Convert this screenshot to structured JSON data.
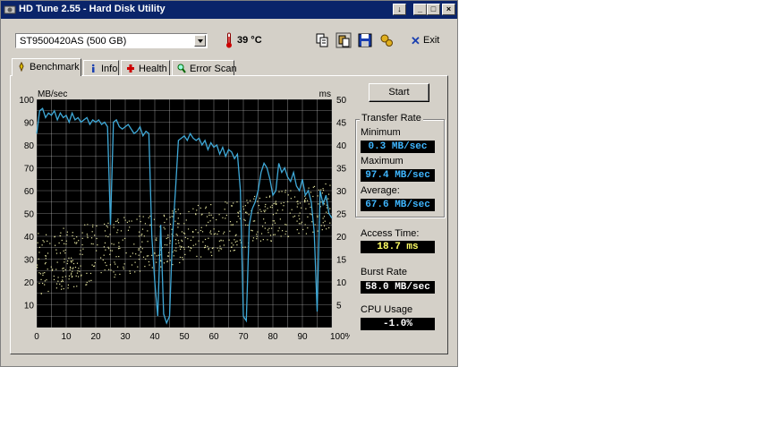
{
  "window": {
    "title": "HD Tune 2.55 - Hard Disk Utility"
  },
  "toolbar": {
    "drive": "ST9500420AS (500 GB)",
    "temperature": "39 °C",
    "exit_label": "Exit"
  },
  "tabs": [
    {
      "label": "Benchmark",
      "icon": "benchmark-icon"
    },
    {
      "label": "Info",
      "icon": "info-icon"
    },
    {
      "label": "Health",
      "icon": "health-icon"
    },
    {
      "label": "Error Scan",
      "icon": "error-scan-icon"
    }
  ],
  "benchmark": {
    "start_label": "Start",
    "group_title": "Transfer Rate",
    "minimum_label": "Minimum",
    "minimum_value": "0.3 MB/sec",
    "maximum_label": "Maximum",
    "maximum_value": "97.4 MB/sec",
    "average_label": "Average:",
    "average_value": "67.6 MB/sec",
    "access_label": "Access Time:",
    "access_value": "18.7 ms",
    "burst_label": "Burst Rate",
    "burst_value": "58.0 MB/sec",
    "cpu_label": "CPU Usage",
    "cpu_value": "-1.0%"
  },
  "colors": {
    "title_bar": "#0a246a",
    "transfer_line": "#3fa9d8",
    "access_dots": "#e6e6a0",
    "grid": "#d8d8d8",
    "value_cyan": "#3fb6ff",
    "value_yellow": "#ffff66",
    "value_white": "#ffffff"
  },
  "chart_data": {
    "type": "line",
    "left_axis_label": "MB/sec",
    "right_axis_label": "ms",
    "ylim": [
      0,
      100
    ],
    "y2lim": [
      0,
      50
    ],
    "xlim": [
      0,
      100
    ],
    "y_ticks": [
      "10",
      "20",
      "30",
      "40",
      "50",
      "60",
      "70",
      "80",
      "90",
      "100"
    ],
    "y2_ticks": [
      "5",
      "10",
      "15",
      "20",
      "25",
      "30",
      "35",
      "40",
      "45",
      "50"
    ],
    "x_ticks": [
      "0",
      "10",
      "20",
      "30",
      "40",
      "50",
      "60",
      "70",
      "80",
      "90",
      "100%"
    ],
    "grid": true,
    "series": [
      {
        "values_kind": "transfer rate (MB/sec)",
        "x": [
          0,
          1,
          2,
          3,
          4,
          5,
          6,
          7,
          8,
          9,
          10,
          11,
          12,
          13,
          14,
          15,
          16,
          17,
          18,
          19,
          20,
          21,
          22,
          23,
          24,
          25,
          26,
          27,
          28,
          29,
          30,
          31,
          32,
          33,
          34,
          35,
          36,
          37,
          38,
          39,
          40,
          41,
          42,
          43,
          44,
          45,
          46,
          47,
          48,
          49,
          50,
          51,
          52,
          53,
          54,
          55,
          56,
          57,
          58,
          59,
          60,
          61,
          62,
          63,
          64,
          65,
          66,
          67,
          68,
          69,
          70,
          71,
          72,
          73,
          74,
          75,
          76,
          77,
          78,
          79,
          80,
          81,
          82,
          83,
          84,
          85,
          86,
          87,
          88,
          89,
          90,
          91,
          92,
          93,
          94,
          95,
          96,
          97,
          98,
          99,
          100
        ],
        "y": [
          85,
          95,
          96,
          92,
          94,
          93,
          95,
          91,
          94,
          92,
          93,
          90,
          94,
          91,
          92,
          90,
          91,
          92,
          89,
          91,
          90,
          91,
          89,
          90,
          88,
          45,
          90,
          91,
          88,
          87,
          88,
          89,
          87,
          85,
          86,
          88,
          84,
          86,
          85,
          40,
          20,
          5,
          45,
          6,
          2,
          5,
          40,
          60,
          82,
          83,
          84,
          82,
          85,
          83,
          82,
          83,
          80,
          82,
          78,
          81,
          79,
          80,
          76,
          79,
          75,
          78,
          77,
          74,
          76,
          60,
          5,
          3,
          45,
          52,
          55,
          60,
          68,
          72,
          70,
          65,
          58,
          60,
          72,
          68,
          70,
          66,
          64,
          68,
          62,
          60,
          65,
          58,
          60,
          55,
          42,
          7,
          60,
          54,
          58,
          50,
          48
        ]
      },
      {
        "values_kind": "access time scatter (ms)",
        "band_start_ms": [
          7,
          21
        ],
        "band_end_ms": [
          22,
          32
        ]
      }
    ]
  }
}
